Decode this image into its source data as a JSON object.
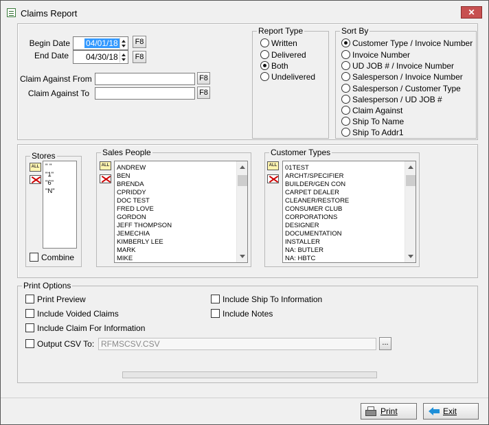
{
  "window": {
    "title": "Claims Report",
    "close_label": "✕"
  },
  "dates": {
    "begin_label": "Begin Date",
    "begin_value": "04/01/18",
    "end_label": "End Date",
    "end_value": "04/30/18",
    "f8": "F8"
  },
  "claim_against": {
    "from_label": "Claim Against From",
    "from_value": "",
    "to_label": "Claim Against To",
    "to_value": "",
    "f8": "F8"
  },
  "report_type": {
    "legend": "Report Type",
    "options": [
      "Written",
      "Delivered",
      "Both",
      "Undelivered"
    ],
    "selected": "Both"
  },
  "sort_by": {
    "legend": "Sort By",
    "options": [
      "Customer Type / Invoice Number",
      "Invoice Number",
      "UD JOB # / Invoice Number",
      "Salesperson / Invoice Number",
      "Salesperson / Customer Type",
      "Salesperson / UD JOB #",
      "Claim Against",
      "Ship To Name",
      "Ship To Addr1"
    ],
    "selected": "Customer Type / Invoice Number"
  },
  "stores": {
    "legend": "Stores",
    "items": [
      "\" \"",
      "\"1\"",
      "\"6\"",
      "\"N\""
    ],
    "combine_label": "Combine",
    "combine_checked": false
  },
  "sales_people": {
    "legend": "Sales People",
    "items": [
      "ANDREW",
      "BEN",
      "BRENDA",
      "CPRIDDY",
      "DOC TEST",
      "FRED LOVE",
      "GORDON",
      "JEFF THOMPSON",
      "JEMECHIA",
      "KIMBERLY LEE",
      "MARK",
      "MIKE"
    ]
  },
  "customer_types": {
    "legend": "Customer Types",
    "items": [
      "01TEST",
      "ARCHT/SPECIFIER",
      "BUILDER/GEN CON",
      "CARPET DEALER",
      "CLEANER/RESTORE",
      "CONSUMER CLUB",
      "CORPORATIONS",
      "DESIGNER",
      "DOCUMENTATION",
      "INSTALLER",
      "NA: BUTLER",
      "NA: HBTC"
    ]
  },
  "list_icons": {
    "all": "ALL",
    "none": ""
  },
  "print_options": {
    "legend": "Print Options",
    "print_preview": "Print Preview",
    "include_voided": "Include Voided Claims",
    "include_claim_for": "Include Claim For Information",
    "include_ship_to": "Include Ship To Information",
    "include_notes": "Include Notes",
    "output_csv_label": "Output CSV To:",
    "output_csv_value": "RFMSCSV.CSV",
    "browse_label": "..."
  },
  "buttons": {
    "print": "Print",
    "exit": "Exit"
  }
}
